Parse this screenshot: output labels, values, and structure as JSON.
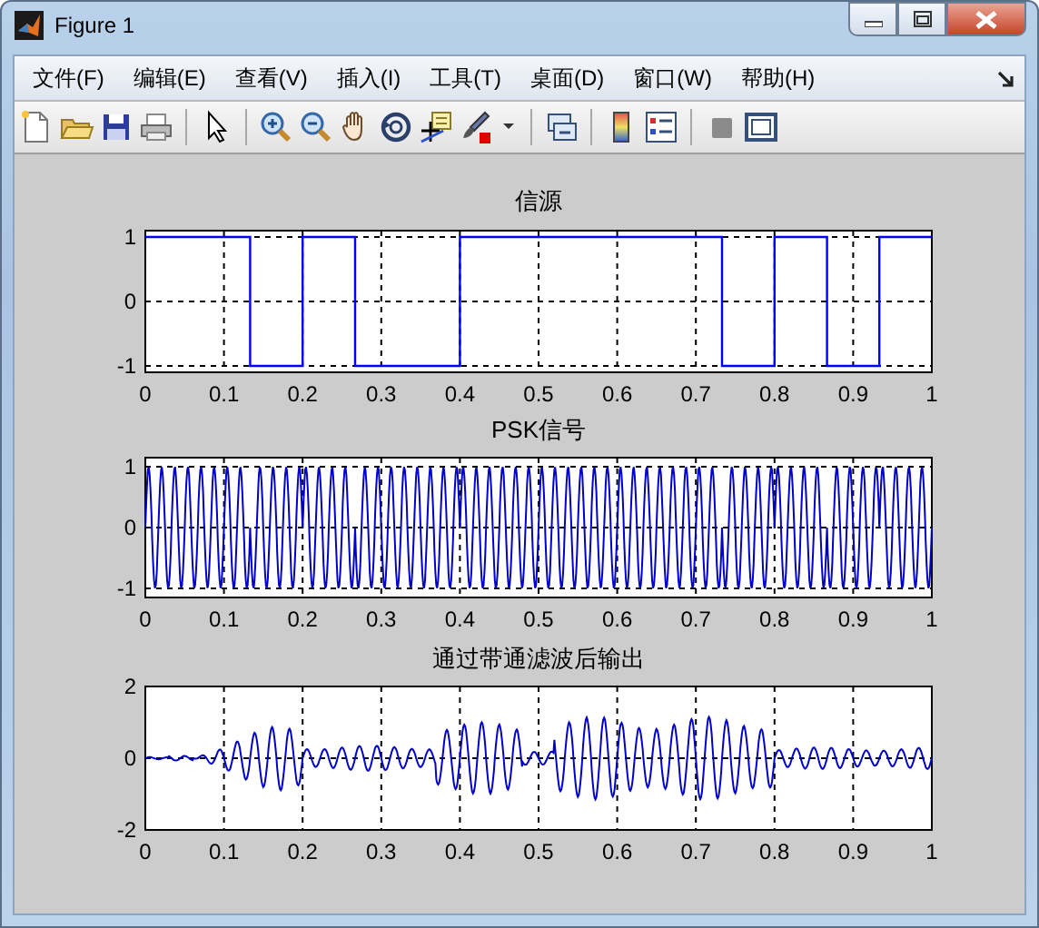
{
  "window": {
    "title": "Figure 1"
  },
  "menu": [
    "文件(F)",
    "编辑(E)",
    "查看(V)",
    "插入(I)",
    "工具(T)",
    "桌面(D)",
    "窗口(W)",
    "帮助(H)"
  ],
  "plots": [
    {
      "kind": "chart",
      "chart_data": {
        "type": "line",
        "title": "信源",
        "x": [
          0,
          0.1333,
          0.1333,
          0.2,
          0.2,
          0.2667,
          0.2667,
          0.4,
          0.4,
          0.7333,
          0.7333,
          0.8,
          0.8,
          0.8667,
          0.8667,
          0.9333,
          0.9333,
          1
        ],
        "series": [
          {
            "color": "#0000ff",
            "values": [
              1,
              1,
              -1,
              -1,
              1,
              1,
              -1,
              -1,
              1,
              1,
              -1,
              -1,
              1,
              1,
              -1,
              -1,
              1,
              1
            ]
          }
        ],
        "xlim": [
          0,
          1
        ],
        "ylim": [
          -1.1,
          1.1
        ],
        "xticks": [
          {
            "value": 0,
            "label": "0"
          },
          {
            "value": 0.1,
            "label": "0.1"
          },
          {
            "value": 0.2,
            "label": "0.2"
          },
          {
            "value": 0.3,
            "label": "0.3"
          },
          {
            "value": 0.4,
            "label": "0.4"
          },
          {
            "value": 0.5,
            "label": "0.5"
          },
          {
            "value": 0.6,
            "label": "0.6"
          },
          {
            "value": 0.7,
            "label": "0.7"
          },
          {
            "value": 0.8,
            "label": "0.8"
          },
          {
            "value": 0.9,
            "label": "0.9"
          },
          {
            "value": 1,
            "label": "1"
          }
        ],
        "yticks": [
          -1,
          0,
          1
        ],
        "grid": true
      }
    },
    {
      "kind": "psk-wave",
      "title": "PSK信号",
      "xticks": [
        "0",
        "0.1",
        "0.2",
        "0.3",
        "0.4",
        "0.5",
        "0.6",
        "0.7",
        "0.8",
        "0.9",
        "1"
      ],
      "yticks": [
        "1",
        "0",
        "-1"
      ]
    },
    {
      "kind": "filtered-wave",
      "title": "通过带通滤波后输出",
      "xticks": [
        "0",
        "0.1",
        "0.2",
        "0.3",
        "0.4",
        "0.5",
        "0.6",
        "0.7",
        "0.8",
        "0.9",
        "1"
      ],
      "yticks": [
        "2",
        "0",
        "-2"
      ]
    }
  ]
}
